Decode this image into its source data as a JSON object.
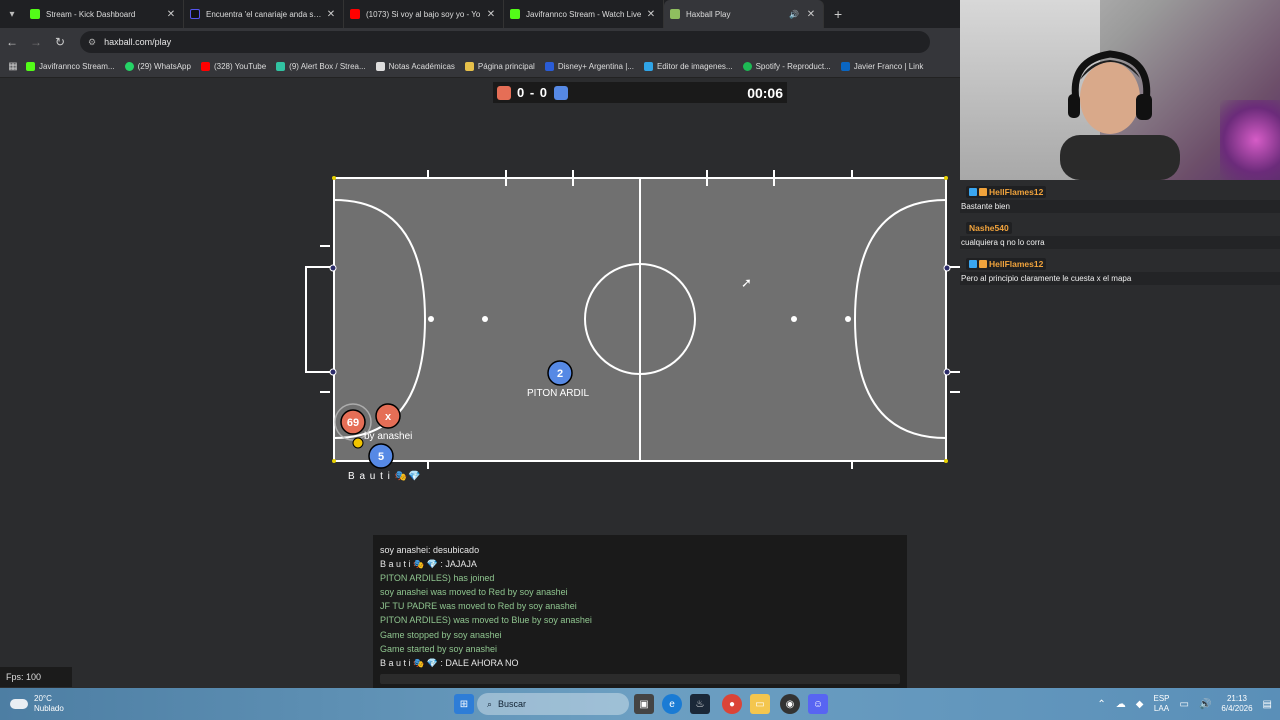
{
  "browser": {
    "tabs": [
      {
        "title": "Stream - Kick Dashboard",
        "color": "#53fc18"
      },
      {
        "title": "Encuentra 'el canariaje anda suelto'",
        "color": "#111111"
      },
      {
        "title": "(1073) Si voy al bajo soy yo - Yo",
        "color": "#ff0000"
      },
      {
        "title": "Javifrannco Stream - Watch Live",
        "color": "#53fc18"
      },
      {
        "title": "Haxball Play",
        "color": "#8fbf5f"
      }
    ],
    "url": "haxball.com/play",
    "bookmarks": [
      {
        "label": "Javifrannco Stream...",
        "color": "#53fc18"
      },
      {
        "label": "(29) WhatsApp",
        "color": "#25d366"
      },
      {
        "label": "(328) YouTube",
        "color": "#ff0000"
      },
      {
        "label": "(9) Alert Box / Strea...",
        "color": "#31c3a2"
      },
      {
        "label": "Notas Académicas",
        "color": "#dddddd"
      },
      {
        "label": "Página principal",
        "color": "#e6c04a"
      },
      {
        "label": "Disney+ Argentina |...",
        "color": "#2a5cd6"
      },
      {
        "label": "Editor de imagenes...",
        "color": "#2fa4e7"
      },
      {
        "label": "Spotify - Reproduct...",
        "color": "#1db954"
      },
      {
        "label": "Javier Franco | Link",
        "color": "#0a66c2"
      }
    ]
  },
  "game": {
    "score": "0 - 0",
    "time": "00:06",
    "red_color": "#e56e56",
    "blue_color": "#5689e5",
    "players": {
      "red_number_1": "69",
      "red_number_2": "x",
      "red_name": "by anashei",
      "blue_number_1": "2",
      "blue_name_1": "PITON ARDIL",
      "blue_number_2": "5",
      "blue_name_2": "B a u t i"
    },
    "fps": "Fps: 100"
  },
  "game_chat": [
    {
      "text": "soy anashei: desubicado",
      "kind": "w"
    },
    {
      "text": "B a u t i 🎭 💎 : JAJAJA",
      "kind": "w"
    },
    {
      "text": "PITON ARDILES) has joined",
      "kind": "g"
    },
    {
      "text": "soy anashei was moved to Red by soy anashei",
      "kind": "g"
    },
    {
      "text": "JF TU PADRE was moved to Red by soy anashei",
      "kind": "g"
    },
    {
      "text": "PITON ARDILES) was moved to Blue by soy anashei",
      "kind": "g"
    },
    {
      "text": "Game stopped by soy anashei",
      "kind": "g"
    },
    {
      "text": "Game started by soy anashei",
      "kind": "g"
    },
    {
      "text": "B a u t i 🎭 💎 : DALE AHORA NO",
      "kind": "w"
    }
  ],
  "stream_chat": [
    {
      "user": "HellFlames12",
      "user_color": "#f1a33c",
      "text": "Bastante bien"
    },
    {
      "user": "Nashe540",
      "user_color": "#f1a33c",
      "text": "cualquiera q no lo corra"
    },
    {
      "user": "HellFlames12",
      "user_color": "#f1a33c",
      "text": "Pero al principio claramente le cuesta x el mapa"
    }
  ],
  "taskbar": {
    "temp": "20°C",
    "weather": "Nublado",
    "search": "Buscar",
    "lang_1": "ESP",
    "lang_2": "LAA",
    "clock_time": "21:13",
    "clock_date": "6/4/2026"
  }
}
